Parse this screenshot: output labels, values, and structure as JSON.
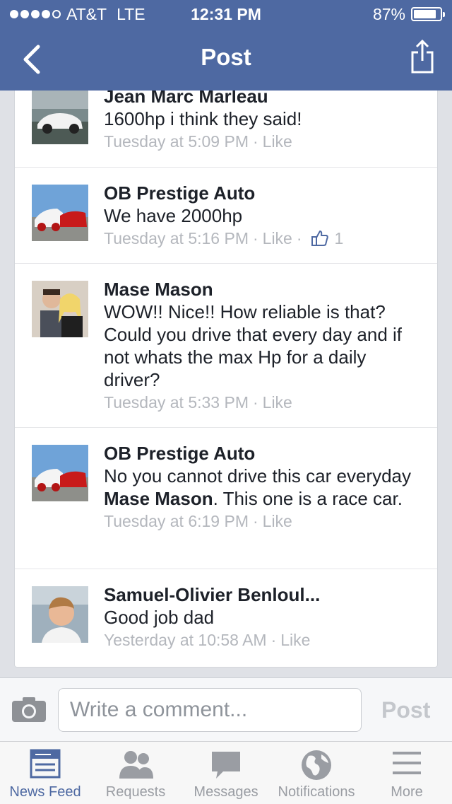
{
  "status_bar": {
    "carrier": "AT&T",
    "network": "LTE",
    "time": "12:31 PM",
    "battery": "87%",
    "battery_level": 0.87,
    "signal_bars": 4
  },
  "nav": {
    "title": "Post",
    "back_icon": "chevron-left-icon",
    "share_icon": "share-icon"
  },
  "comments": [
    {
      "author": "Jean Marc Marleau",
      "text": "1600hp i think they said!",
      "time": "Tuesday at 5:09 PM",
      "like_label": "Like"
    },
    {
      "author": "OB Prestige Auto",
      "text": "We have 2000hp",
      "time": "Tuesday at 5:16 PM",
      "like_label": "Like",
      "like_count": "1"
    },
    {
      "author": "Mase Mason",
      "text": "WOW!! Nice!! How reliable is that? Could you drive that every day and if not whats the max Hp for a daily driver?",
      "time": "Tuesday at 5:33 PM",
      "like_label": "Like"
    },
    {
      "author": "OB Prestige Auto",
      "text_before": "No you cannot drive this car everyday ",
      "mention": "Mase Mason",
      "text_after": ". This one is a race car.",
      "time": "Tuesday at 6:19 PM",
      "like_label": "Like"
    },
    {
      "author": "Samuel-Olivier Benloul...",
      "text": "Good job dad",
      "time": "Yesterday at 10:58 AM",
      "like_label": "Like"
    }
  ],
  "composer": {
    "placeholder": "Write a comment...",
    "post_label": "Post",
    "camera_icon": "camera-icon"
  },
  "tabs": [
    {
      "label": "News Feed",
      "icon": "news-feed-icon",
      "active": true
    },
    {
      "label": "Requests",
      "icon": "friend-requests-icon"
    },
    {
      "label": "Messages",
      "icon": "messages-icon"
    },
    {
      "label": "Notifications",
      "icon": "globe-icon"
    },
    {
      "label": "More",
      "icon": "menu-icon"
    }
  ],
  "colors": {
    "brand_blue": "#4e69a2",
    "meta_gray": "#b4b7bd",
    "background": "#dfe1e6"
  }
}
